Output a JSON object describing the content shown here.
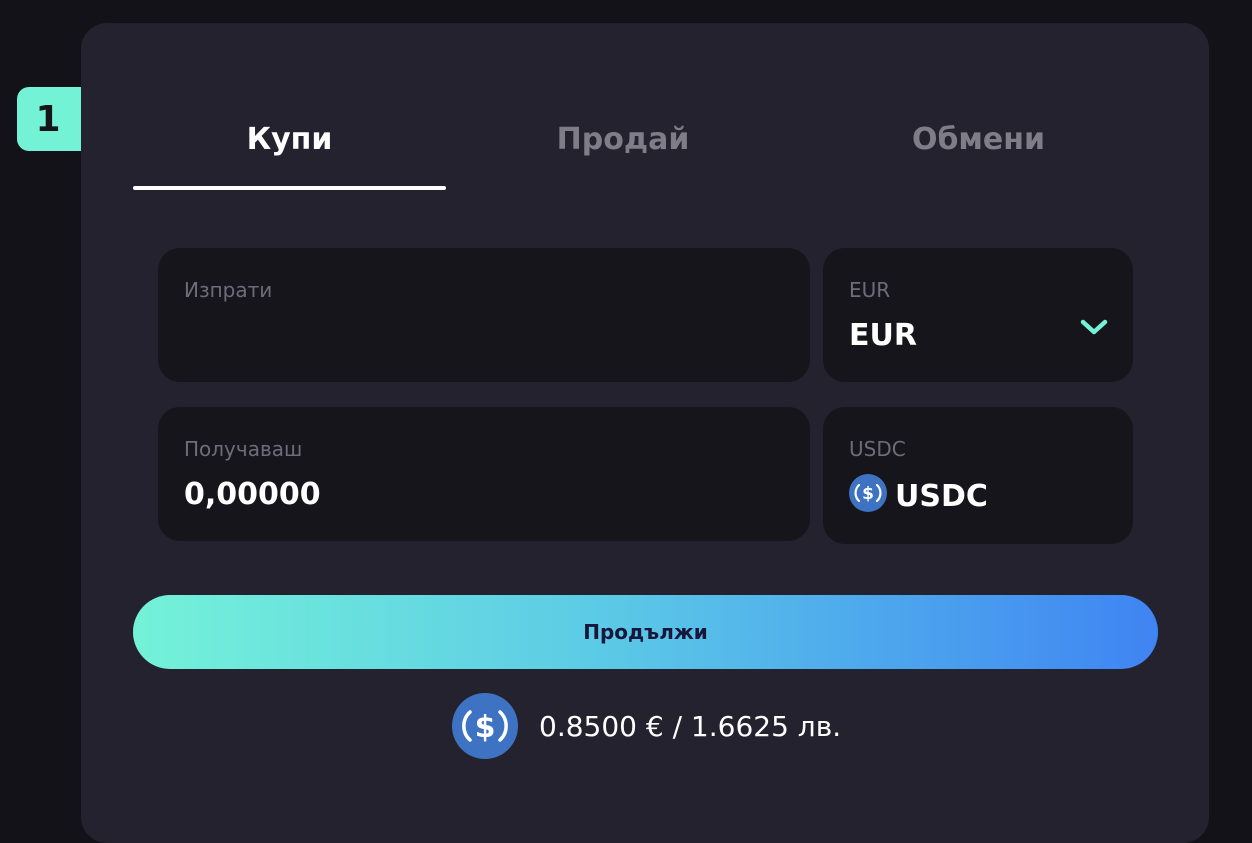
{
  "step": {
    "number": "1"
  },
  "tabs": [
    {
      "label": "Купи",
      "active": true
    },
    {
      "label": "Продай",
      "active": false
    },
    {
      "label": "Обмени",
      "active": false
    }
  ],
  "send": {
    "label": "Изпрати",
    "value": "",
    "placeholder": ""
  },
  "send_currency": {
    "label": "EUR",
    "value": "EUR",
    "icon": "chevron-down-icon"
  },
  "receive": {
    "label": "Получаваш",
    "value": "0,00000"
  },
  "receive_currency": {
    "label": "USDC",
    "value": "USDC",
    "icon": "usdc-icon"
  },
  "continue_button": {
    "label": "Продължи"
  },
  "rate": {
    "text": "0.8500 € / 1.6625 лв.",
    "icon": "usdc-icon"
  },
  "colors": {
    "accent": "#74f2d5",
    "background": "#131218",
    "card": "#23222e",
    "field": "#16151c",
    "usdc_blue": "#3e73c4",
    "gradient_start": "#74f2d8",
    "gradient_end": "#3f84f3"
  }
}
